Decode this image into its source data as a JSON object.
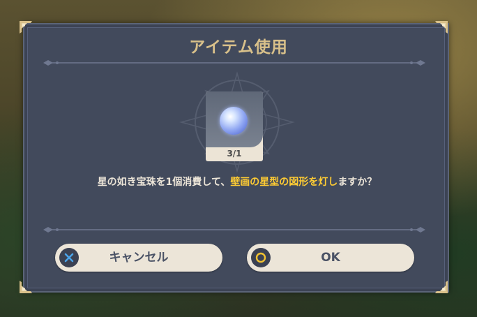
{
  "dialog": {
    "title": "アイテム使用",
    "item": {
      "icon": "crystal-orb-icon",
      "count": "3/1"
    },
    "message": {
      "part1": "星の如き宝珠を1個消費して、",
      "highlight": "壁画の星型の図形を灯し",
      "part2": "ますか？",
      "highlight_color": "#ffcc33"
    },
    "buttons": {
      "cancel": {
        "label": "キャンセル",
        "icon": "cross-icon",
        "icon_color": "#4aa3e8"
      },
      "ok": {
        "label": "OK",
        "icon": "circle-icon",
        "icon_color": "#f2c230"
      }
    }
  }
}
